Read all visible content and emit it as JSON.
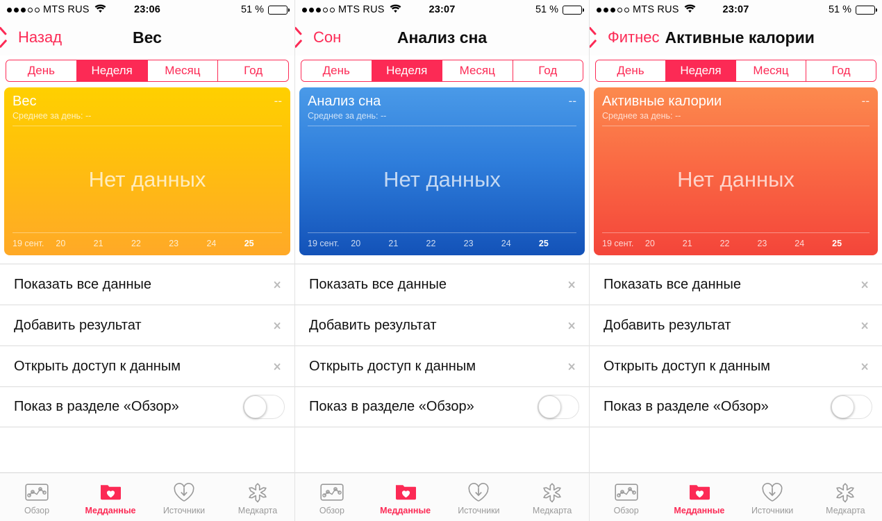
{
  "statusbar": {
    "carrier": "MTS RUS",
    "signal_dots_filled": 3,
    "signal_dots_total": 5,
    "wifi_icon": "wifi-icon",
    "battery_percent": "51 %",
    "battery_level": 51,
    "times": [
      "23:06",
      "23:07",
      "23:07"
    ]
  },
  "segments": {
    "items": [
      "День",
      "Неделя",
      "Месяц",
      "Год"
    ],
    "active_index": 1
  },
  "list": {
    "rows": [
      {
        "label": "Показать все данные",
        "accessory": "chevron"
      },
      {
        "label": "Добавить результат",
        "accessory": "chevron"
      },
      {
        "label": "Открыть доступ к данным",
        "accessory": "chevron"
      },
      {
        "label": "Показ в разделе «Обзор»",
        "accessory": "toggle",
        "toggle_on": false
      }
    ]
  },
  "tabbar": {
    "items": [
      {
        "label": "Обзор",
        "icon": "chart-overview-icon",
        "active": false
      },
      {
        "label": "Медданные",
        "icon": "folder-heart-icon",
        "active": true
      },
      {
        "label": "Источники",
        "icon": "heart-download-icon",
        "active": false
      },
      {
        "label": "Медкарта",
        "icon": "medical-asterisk-icon",
        "active": false
      }
    ]
  },
  "colors": {
    "accent": "#fc2a55",
    "card_yellow": "#ffc20a",
    "card_blue": "#2e7ddb",
    "card_orange": "#fa6a44",
    "tab_inactive": "#9a9a9a"
  },
  "panels": [
    {
      "back_label": "Назад",
      "title": "Вес",
      "title_centered": true,
      "card": {
        "theme": "yellow",
        "title": "Вес",
        "value": "--",
        "subtitle": "Среднее за день: --",
        "empty_message": "Нет данных",
        "axis": [
          "19 сент.",
          "20",
          "21",
          "22",
          "23",
          "24",
          "25"
        ],
        "axis_bold_index": 6
      }
    },
    {
      "back_label": "Сон",
      "title": "Анализ сна",
      "title_centered": true,
      "card": {
        "theme": "blue",
        "title": "Анализ сна",
        "value": "--",
        "subtitle": "Среднее за день: --",
        "empty_message": "Нет данных",
        "axis": [
          "19 сент.",
          "20",
          "21",
          "22",
          "23",
          "24",
          "25"
        ],
        "axis_bold_index": 6
      }
    },
    {
      "back_label": "Фитнес",
      "title": "Активные калории",
      "title_centered": false,
      "card": {
        "theme": "orange",
        "title": "Активные калории",
        "value": "--",
        "subtitle": "Среднее за день: --",
        "empty_message": "Нет данных",
        "axis": [
          "19 сент.",
          "20",
          "21",
          "22",
          "23",
          "24",
          "25"
        ],
        "axis_bold_index": 6
      }
    }
  ],
  "chart_data": [
    {
      "type": "bar",
      "title": "Вес",
      "subtitle": "Среднее за день: --",
      "categories": [
        "19 сент.",
        "20",
        "21",
        "22",
        "23",
        "24",
        "25"
      ],
      "values": [
        null,
        null,
        null,
        null,
        null,
        null,
        null
      ],
      "xlabel": "",
      "ylabel": "",
      "annotation": "Нет данных",
      "legend": "none",
      "grid": false
    },
    {
      "type": "bar",
      "title": "Анализ сна",
      "subtitle": "Среднее за день: --",
      "categories": [
        "19 сент.",
        "20",
        "21",
        "22",
        "23",
        "24",
        "25"
      ],
      "values": [
        null,
        null,
        null,
        null,
        null,
        null,
        null
      ],
      "xlabel": "",
      "ylabel": "",
      "annotation": "Нет данных",
      "legend": "none",
      "grid": false
    },
    {
      "type": "bar",
      "title": "Активные калории",
      "subtitle": "Среднее за день: --",
      "categories": [
        "19 сент.",
        "20",
        "21",
        "22",
        "23",
        "24",
        "25"
      ],
      "values": [
        null,
        null,
        null,
        null,
        null,
        null,
        null
      ],
      "xlabel": "",
      "ylabel": "",
      "annotation": "Нет данных",
      "legend": "none",
      "grid": false
    }
  ]
}
